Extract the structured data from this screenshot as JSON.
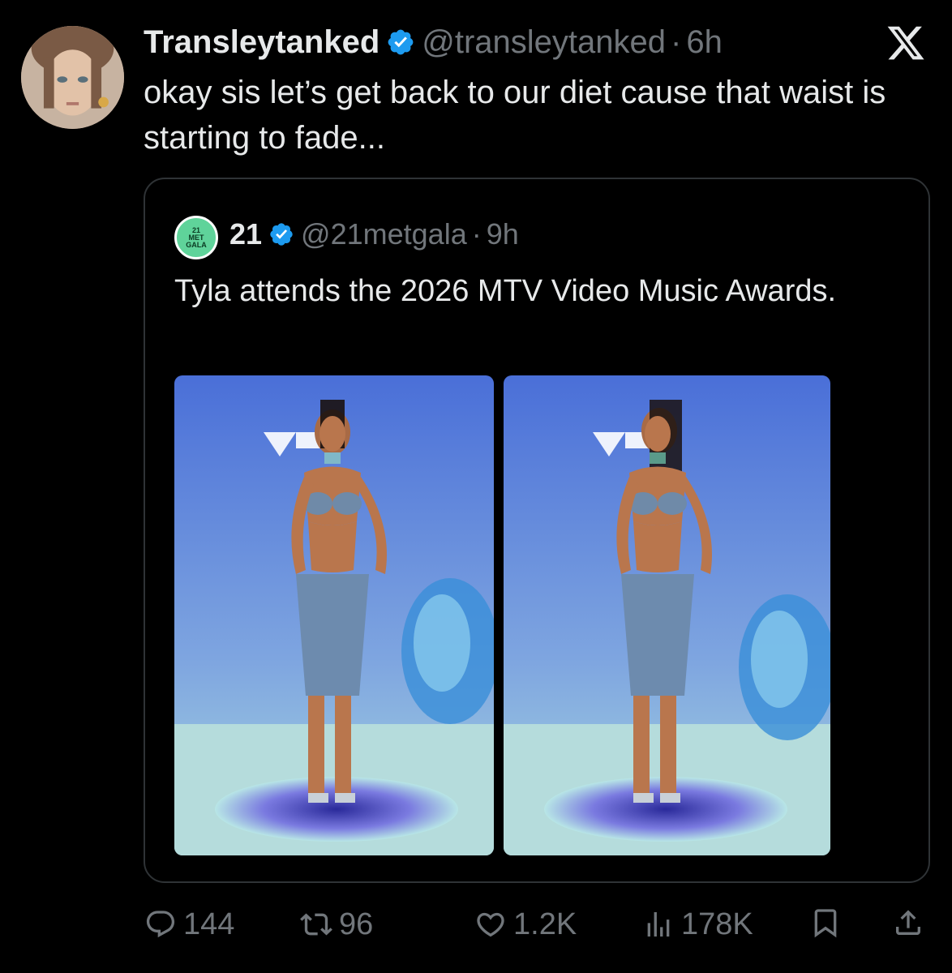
{
  "tweet": {
    "display_name": "Transleytanked",
    "handle": "@transleytanked",
    "separator": "·",
    "time": "6h",
    "text": "okay sis let’s get back to our diet cause that waist is starting to fade..."
  },
  "quoted": {
    "avatar_text": [
      "21",
      "MET",
      "GALA"
    ],
    "display_name": "21",
    "handle": "@21metgala",
    "separator": "·",
    "time": "9h",
    "text": "Tyla attends the 2026 MTV Video Music Awards."
  },
  "actions": {
    "replies": "144",
    "reposts": "96",
    "likes": "1.2K",
    "views": "178K"
  },
  "colors": {
    "background": "#000000",
    "text": "#e7e9ea",
    "muted": "#71767b",
    "verified": "#1d9bf0",
    "border": "#2f3336"
  },
  "icons": [
    "verified-badge-icon",
    "x-logo-icon",
    "reply-icon",
    "repost-icon",
    "like-icon",
    "views-icon",
    "bookmark-icon",
    "share-icon"
  ]
}
